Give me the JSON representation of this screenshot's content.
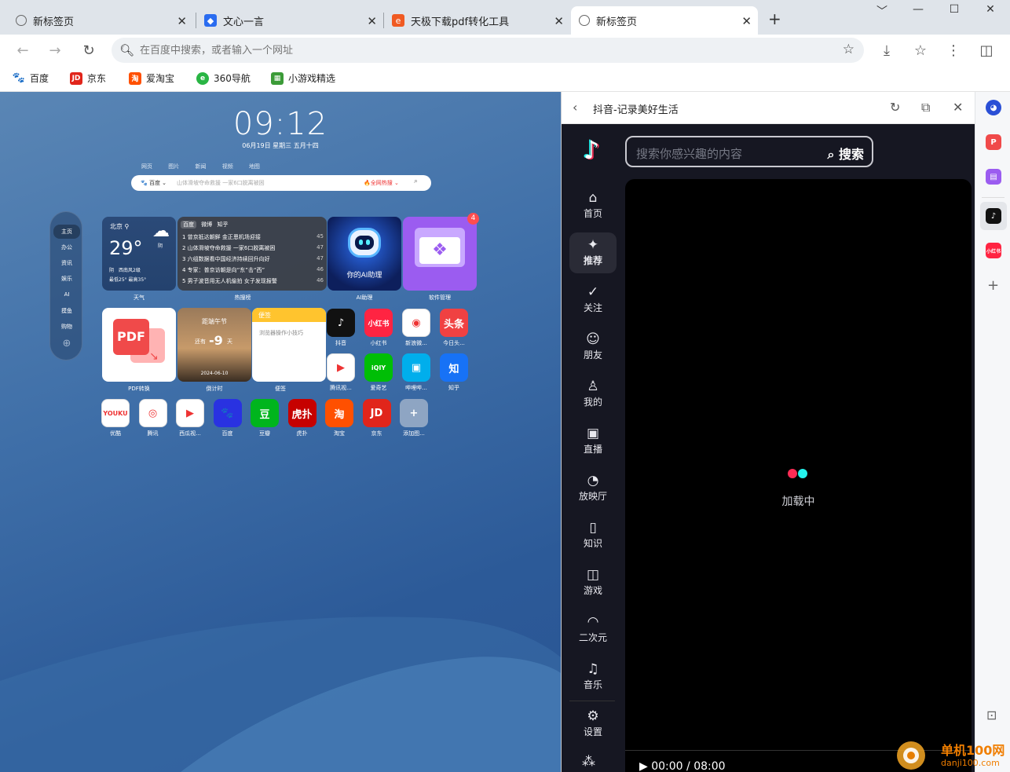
{
  "tabs": [
    {
      "title": "新标签页",
      "icon": "newtab-icon"
    },
    {
      "title": "文心一言",
      "icon": "wenxin-icon"
    },
    {
      "title": "天极下载pdf转化工具",
      "icon": "tianji-icon"
    },
    {
      "title": "新标签页",
      "icon": "newtab-icon",
      "active": true
    }
  ],
  "new_tab_symbol": "+",
  "window": {
    "min": "﹀",
    "minimize": "—",
    "maximize": "☐",
    "close": "✕"
  },
  "omnibox": {
    "placeholder": "在百度中搜索，或者输入一个网址"
  },
  "bookmarks": [
    {
      "label": "百度",
      "icon": "baidu-icon",
      "color": "#2932e1"
    },
    {
      "label": "京东",
      "icon": "jd-icon",
      "color": "#e1251b"
    },
    {
      "label": "爱淘宝",
      "icon": "taobao-icon",
      "color": "#ff5000"
    },
    {
      "label": "360导航",
      "icon": "360-icon",
      "color": "#29b544"
    },
    {
      "label": "小游戏精选",
      "icon": "game-icon",
      "color": "#3c9b38"
    }
  ],
  "newtab": {
    "clock": "09:12",
    "date": "06月19日 星期三 五月十四",
    "search_tabs": [
      "网页",
      "图片",
      "新闻",
      "视频",
      "地图"
    ],
    "search": {
      "engine": "百度",
      "placeholder": "山体滑坡夺命救援 一家6口脱离被困",
      "hot": "全网热搜"
    },
    "side_nav": [
      "主页",
      "办公",
      "资讯",
      "娱乐",
      "AI",
      "摸鱼",
      "购物"
    ],
    "weather": {
      "city": "北京",
      "temp": "29°",
      "cond": "阴",
      "wind": "阴　西南风2级",
      "range": "最低25° 最高35°",
      "caption": "天气"
    },
    "hot": {
      "tabs": [
        "百度",
        "微博",
        "知乎"
      ],
      "items": [
        {
          "text": "1 曾京抵达朝鲜 金正恩机场迎接",
          "n": "45"
        },
        {
          "text": "2 山体滑坡夺命救援 一家6口脱离被困",
          "n": "47"
        },
        {
          "text": "3 六组数据看中国经济持续回升向好",
          "n": "47"
        },
        {
          "text": "4 专家：普京访朝是向“东”击“西”",
          "n": "46"
        },
        {
          "text": "5 男子波音用无人机偷拍 女子发现报警",
          "n": "46"
        }
      ],
      "caption": "热搜榜"
    },
    "ai": {
      "label": "你的AI助理",
      "caption": "AI助理"
    },
    "softmgr": {
      "caption": "软件管理",
      "badge": "4"
    },
    "pdf": {
      "label": "PDF",
      "caption": "PDF转换"
    },
    "countdown": {
      "title": "距端午节",
      "prefix": "还有",
      "days": "-9",
      "unit": "天",
      "date": "2024-06-10",
      "caption": "倒计时"
    },
    "note": {
      "title": "便签",
      "text": "浏览器操作小技巧",
      "caption": "便签"
    },
    "apps_row1": [
      {
        "name": "抖音",
        "glyph": "♪",
        "color": "#111"
      },
      {
        "name": "小红书",
        "glyph": "小红书",
        "color": "#ff2442"
      },
      {
        "name": "新浪微...",
        "glyph": "◉",
        "color": "#fff"
      },
      {
        "name": "今日头...",
        "glyph": "头条",
        "color": "#f04142"
      }
    ],
    "apps_row2": [
      {
        "name": "腾讯视...",
        "glyph": "▶",
        "color": "#fff"
      },
      {
        "name": "爱奇艺",
        "glyph": "iQIY",
        "color": "#00be06"
      },
      {
        "name": "哔哩哔...",
        "glyph": "▣",
        "color": "#00aeec"
      },
      {
        "name": "知乎",
        "glyph": "知",
        "color": "#1772f6"
      }
    ],
    "apps_row3": [
      {
        "name": "优酷",
        "glyph": "YOUKU",
        "color": "#fff"
      },
      {
        "name": "腾讯",
        "glyph": "◎",
        "color": "#fff"
      },
      {
        "name": "西瓜视...",
        "glyph": "▶",
        "color": "#fff"
      },
      {
        "name": "百度",
        "glyph": "🐾",
        "color": "#2932e1"
      },
      {
        "name": "豆瓣",
        "glyph": "豆",
        "color": "#00b51d"
      },
      {
        "name": "虎扑",
        "glyph": "虎扑",
        "color": "#c60100"
      },
      {
        "name": "淘宝",
        "glyph": "淘",
        "color": "#ff5000"
      },
      {
        "name": "京东",
        "glyph": "JD",
        "color": "#e1251b"
      },
      {
        "name": "添加图...",
        "glyph": "+",
        "color": "#8ea5c3"
      }
    ]
  },
  "panel": {
    "title": "抖音-记录美好生活",
    "search_placeholder": "搜索你感兴趣的内容",
    "search_button": "搜索",
    "nav": [
      {
        "label": "首页",
        "icon": "home-icon",
        "glyph": "⌂"
      },
      {
        "label": "推荐",
        "icon": "sparkle-icon",
        "glyph": "✦"
      },
      {
        "label": "关注",
        "icon": "follow-icon",
        "glyph": "✓"
      },
      {
        "label": "朋友",
        "icon": "friends-icon",
        "glyph": "☺"
      },
      {
        "label": "我的",
        "icon": "user-icon",
        "glyph": "♙"
      },
      {
        "label": "直播",
        "icon": "tv-icon",
        "glyph": "▣"
      },
      {
        "label": "放映厅",
        "icon": "cinema-icon",
        "glyph": "◔"
      },
      {
        "label": "知识",
        "icon": "book-icon",
        "glyph": "▯"
      },
      {
        "label": "游戏",
        "icon": "gamepad-icon",
        "glyph": "◫"
      },
      {
        "label": "二次元",
        "icon": "ghost-icon",
        "glyph": "◠"
      },
      {
        "label": "音乐",
        "icon": "music-icon",
        "glyph": "♫"
      },
      {
        "label": "设置",
        "icon": "settings-icon",
        "glyph": "⚙"
      }
    ],
    "loading": "加载中",
    "time": "00:00 / 08:00"
  },
  "watermark": {
    "title": "单机100网",
    "url": "danji100.com"
  }
}
